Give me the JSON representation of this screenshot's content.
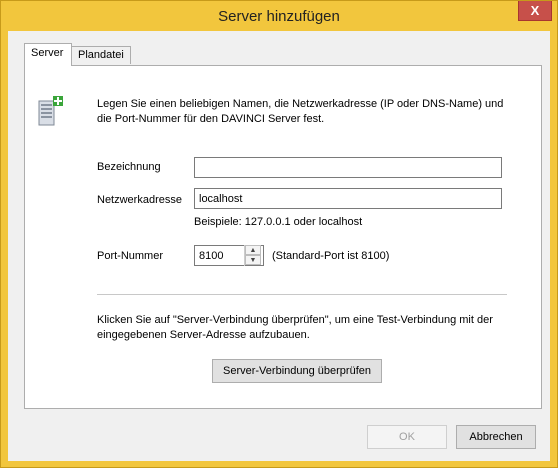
{
  "window": {
    "title": "Server hinzufügen",
    "close_label": "X"
  },
  "tabs": [
    {
      "label": "Server"
    },
    {
      "label": "Plandatei"
    }
  ],
  "intro_text": "Legen Sie einen beliebigen Namen, die Netzwerkadresse (IP oder DNS-Name) und die Port-Nummer für den DAVINCI Server fest.",
  "fields": {
    "name": {
      "label": "Bezeichnung",
      "value": ""
    },
    "address": {
      "label": "Netzwerkadresse",
      "value": "localhost",
      "hint": "Beispiele: 127.0.0.1 oder localhost"
    },
    "port": {
      "label": "Port-Nummer",
      "value": "8100",
      "hint": "(Standard-Port ist 8100)"
    }
  },
  "check": {
    "text": "Klicken Sie auf \"Server-Verbindung überprüfen\", um eine Test-Verbindung mit der eingegebenen Server-Adresse aufzubauen.",
    "button_label": "Server-Verbindung überprüfen"
  },
  "footer": {
    "ok_label": "OK",
    "cancel_label": "Abbrechen"
  },
  "colors": {
    "frame": "#f2c63d",
    "close": "#c7504a",
    "panel": "#ffffff",
    "client": "#f0f0f0"
  }
}
